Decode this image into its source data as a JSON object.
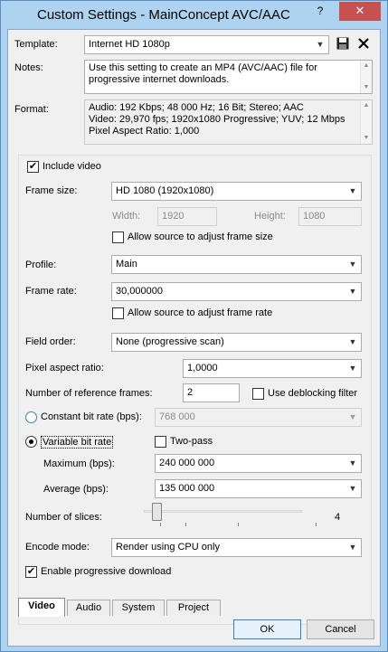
{
  "window": {
    "title": "Custom Settings - MainConcept AVC/AAC",
    "help_glyph": "?",
    "close_glyph": "✕"
  },
  "template": {
    "label": "Template:",
    "value": "Internet HD 1080p"
  },
  "notes": {
    "label": "Notes:",
    "text": "Use this setting to create an MP4 (AVC/AAC) file for progressive internet downloads."
  },
  "format": {
    "label": "Format:",
    "lines": [
      "Audio: 192 Kbps; 48 000 Hz; 16 Bit; Stereo; AAC",
      "Video: 29,970 fps; 1920x1080 Progressive; YUV; 12 Mbps",
      "Pixel Aspect Ratio: 1,000"
    ]
  },
  "video": {
    "include_video": {
      "label": "Include video",
      "checked": true
    },
    "frame_size": {
      "label": "Frame size:",
      "value": "HD 1080 (1920x1080)"
    },
    "width": {
      "label": "Width:",
      "value": "1920"
    },
    "height": {
      "label": "Height:",
      "value": "1080"
    },
    "allow_frame_size": {
      "label": "Allow source to adjust frame size",
      "checked": false
    },
    "profile": {
      "label": "Profile:",
      "value": "Main"
    },
    "frame_rate": {
      "label": "Frame rate:",
      "value": "30,000000"
    },
    "allow_frame_rate": {
      "label": "Allow source to adjust frame rate",
      "checked": false
    },
    "field_order": {
      "label": "Field order:",
      "value": "None (progressive scan)"
    },
    "pixel_aspect": {
      "label": "Pixel aspect ratio:",
      "value": "1,0000"
    },
    "ref_frames": {
      "label": "Number of reference frames:",
      "value": "2"
    },
    "deblocking": {
      "label": "Use deblocking filter",
      "checked": false
    },
    "cbr": {
      "label": "Constant bit rate (bps):",
      "value": "768 000",
      "selected": false
    },
    "vbr": {
      "label": "Variable bit rate",
      "selected": true
    },
    "two_pass": {
      "label": "Two-pass",
      "checked": false
    },
    "maximum": {
      "label": "Maximum (bps):",
      "value": "240 000 000"
    },
    "average": {
      "label": "Average (bps):",
      "value": "135 000 000"
    },
    "slices": {
      "label": "Number of slices:",
      "value": "4",
      "slider_fraction": 0.06
    },
    "encode_mode": {
      "label": "Encode mode:",
      "value": "Render using CPU only"
    },
    "progressive_download": {
      "label": "Enable progressive download",
      "checked": true
    }
  },
  "tabs": [
    {
      "label": "Video",
      "active": true
    },
    {
      "label": "Audio",
      "active": false
    },
    {
      "label": "System",
      "active": false
    },
    {
      "label": "Project",
      "active": false
    }
  ],
  "buttons": {
    "ok": "OK",
    "cancel": "Cancel"
  },
  "icons": {
    "save": "save-icon",
    "delete": "delete-icon",
    "dropdown": "chevron-down-icon"
  },
  "colors": {
    "titlebar": "#aed3f1",
    "close_button": "#c75050",
    "dialog_bg": "#f0f0f0",
    "accent": "#3c7fb1"
  }
}
